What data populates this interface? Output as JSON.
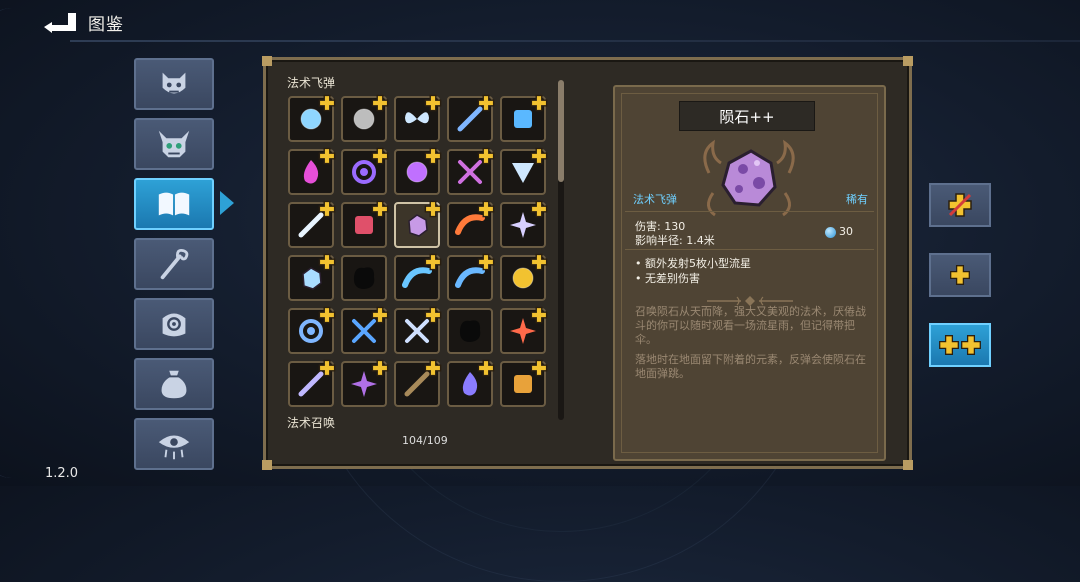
{
  "header": {
    "title": "图鉴",
    "back_icon": "back-arrow-icon"
  },
  "version": "1.2.0",
  "categories": [
    {
      "name": "monster",
      "icon": "demon-face-icon",
      "active": false
    },
    {
      "name": "boss",
      "icon": "horned-skull-icon",
      "active": false
    },
    {
      "name": "codex",
      "icon": "open-book-icon",
      "active": true
    },
    {
      "name": "staff",
      "icon": "staff-icon",
      "active": false
    },
    {
      "name": "relic",
      "icon": "eye-hand-icon",
      "active": false
    },
    {
      "name": "bag",
      "icon": "pouch-icon",
      "active": false
    },
    {
      "name": "curse",
      "icon": "weeping-eye-icon",
      "active": false
    }
  ],
  "grid": {
    "section_title": "法术飞弹",
    "next_section_title": "法术召唤",
    "counter": "104/109",
    "rows": [
      [
        "frost-orb",
        "stone-orb",
        "butterfly",
        "wand-bolt",
        "spiral-glyph"
      ],
      [
        "pink-flame",
        "purple-vortex",
        "violet-orb",
        "crossed-arrows",
        "ice-claw"
      ],
      [
        "light-beam",
        "red-dice",
        "meteor",
        "rainbow-wave",
        "sparkle-star"
      ],
      [
        "ice-fist",
        "shadow-beast",
        "lightning-swirl",
        "water-wave",
        "gold-coin"
      ],
      [
        "blue-scythe",
        "blue-claws",
        "blade-swirl",
        "shadow-blob",
        "fire-flower"
      ],
      [
        "arrow-barrage",
        "hex-star",
        "brown-arrow",
        "comet",
        "golden-scroll"
      ]
    ],
    "selected": [
      2,
      2
    ],
    "locked": [
      [
        3,
        1
      ],
      [
        4,
        3
      ]
    ]
  },
  "detail": {
    "name": "陨石++",
    "type": "法术飞弹",
    "rarity": "稀有",
    "damage_label": "伤害: 130",
    "radius_label": "影响半径: 1.4米",
    "mana": "30",
    "bullets": [
      "额外发射5枚小型流星",
      "无差别伤害"
    ],
    "desc1": "召唤陨石从天而降，强大又美观的法术，厌倦战斗的你可以随时观看一场流星雨，但记得带把伞。",
    "desc2": "落地时在地面留下附着的元素，反弹会使陨石在地面弹跳。"
  },
  "side_buttons": [
    {
      "name": "no-upgrade",
      "icon": "slashed-plus-icon",
      "active": false
    },
    {
      "name": "upgrade-1",
      "icon": "plus-icon",
      "active": false
    },
    {
      "name": "upgrade-2",
      "icon": "double-plus-icon",
      "active": true
    }
  ],
  "colors": {
    "accent": "#2ea1d6",
    "gold": "#f2c230",
    "frame": "#7e6d4e"
  }
}
